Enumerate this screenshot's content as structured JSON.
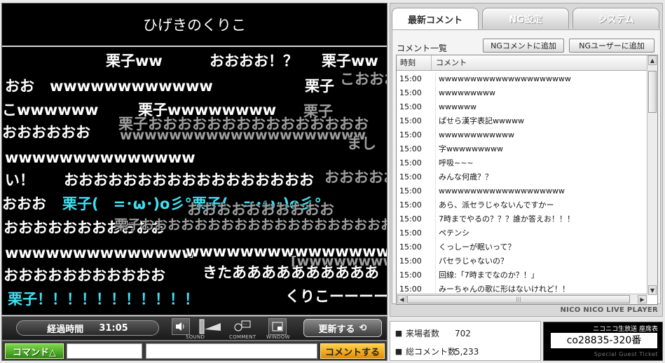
{
  "player": {
    "title": "ひげきのくりこ",
    "comments": [
      {
        "text": "栗子ww",
        "kind": "white"
      },
      {
        "text": "おおおお！？",
        "kind": "white"
      },
      {
        "text": "栗子ww",
        "kind": "white"
      },
      {
        "text": "おお",
        "kind": "white"
      },
      {
        "text": "wwwwwwwwwwww",
        "kind": "white"
      },
      {
        "text": "栗子",
        "kind": "white"
      },
      {
        "text": "こおおお",
        "kind": "ghost"
      },
      {
        "text": "こwwwwww",
        "kind": "white"
      },
      {
        "text": "栗子wwwwwwww",
        "kind": "white"
      },
      {
        "text": "栗子",
        "kind": "ghost"
      },
      {
        "text": "おおおおおお",
        "kind": "white"
      },
      {
        "text": "栗子おおおおおおおおおおおおおおお",
        "kind": "ghost"
      },
      {
        "text": "wwwwwwwwwwwwwwwwwwww",
        "kind": "ghost"
      },
      {
        "text": "まし",
        "kind": "ghost"
      },
      {
        "text": "wwwwwwwwwwwwww",
        "kind": "white"
      },
      {
        "text": "い！",
        "kind": "white"
      },
      {
        "text": "おおおおおおおおおおおおおおおおお",
        "kind": "white"
      },
      {
        "text": "おおおおおお",
        "kind": "ghost"
      },
      {
        "text": "おおお",
        "kind": "white"
      },
      {
        "text": "栗子(　=･ω･)o彡°栗子(　=･ω･)o彡°",
        "kind": "cyan"
      },
      {
        "text": "おおおおおおおおおお",
        "kind": "ghost"
      },
      {
        "text": "おおおおおおおおおおお",
        "kind": "white"
      },
      {
        "text": "栗子おおおおおおおおおおおおおおおおおおおおお",
        "kind": "ghost"
      },
      {
        "text": "wwwwwwwwwwwwww",
        "kind": "white"
      },
      {
        "text": "wwwwwwwwwwwwwwwwwwwwwwwwww",
        "kind": "white"
      },
      {
        "text": "[wwwwwwwwwwwwwwwwwwwwwww",
        "kind": "ghost"
      },
      {
        "text": "おおおおおおおおおおお",
        "kind": "white"
      },
      {
        "text": "きたああああああああああ",
        "kind": "white"
      },
      {
        "text": "栗子！！！！！！！！！！！",
        "kind": "cyan"
      },
      {
        "text": "くりこーーーーー",
        "kind": "white"
      }
    ]
  },
  "controls": {
    "elapsed_label": "経過時間",
    "elapsed_time": "31:05",
    "sound_label": "SOUND",
    "comment_label": "COMMENT",
    "window_label": "WINDOW",
    "refresh_label": "更新する",
    "command_label": "コマンド△",
    "submit_label": "コメントする"
  },
  "tabs": [
    {
      "label": "最新コメント",
      "active": true
    },
    {
      "label": "NG設定",
      "active": false
    },
    {
      "label": "システム",
      "active": false
    }
  ],
  "comment_list": {
    "title": "コメント一覧",
    "ng_comment_button": "NGコメントに追加",
    "ng_user_button": "NGユーザーに追加",
    "col_time": "時刻",
    "col_comment": "コメント",
    "rows": [
      {
        "time": "15:00",
        "comment": "wwwwwwwwwwwwwwwwwwwww"
      },
      {
        "time": "15:00",
        "comment": "wwwwwwwww"
      },
      {
        "time": "15:00",
        "comment": "wwwwww"
      },
      {
        "time": "15:00",
        "comment": "ぱせら漢字表記wwwww"
      },
      {
        "time": "15:00",
        "comment": "wwwwwwwwwwww"
      },
      {
        "time": "15:00",
        "comment": "字wwwwwwwww"
      },
      {
        "time": "15:00",
        "comment": "呼吸~~~"
      },
      {
        "time": "15:00",
        "comment": "みんな何歳？？"
      },
      {
        "time": "15:00",
        "comment": "wwwwwwwwwwwwwwwwwwww"
      },
      {
        "time": "15:00",
        "comment": "あら、派セラじゃないんですかー"
      },
      {
        "time": "15:00",
        "comment": "7時までやるの？？？誰か答えお！！！"
      },
      {
        "time": "15:00",
        "comment": "ペテンシ"
      },
      {
        "time": "15:00",
        "comment": "くっしーが眠いって？"
      },
      {
        "time": "15:00",
        "comment": "パセラじゃないの？"
      },
      {
        "time": "15:00",
        "comment": "回線:「7時までなのか？！」"
      },
      {
        "time": "15:00",
        "comment": "みーちゃんの歌に形はないけれど！！"
      }
    ],
    "brand": "NICO NICO LIVE PLAYER"
  },
  "stats": {
    "visitors_label": "来場者数",
    "visitors_value": "702",
    "comments_label": "総コメント数",
    "comments_value": "5,233"
  },
  "ticket": {
    "header": "ニコニコ生放送 座席表",
    "number": "co28835-320番",
    "footer": "Special Guest Ticket"
  }
}
